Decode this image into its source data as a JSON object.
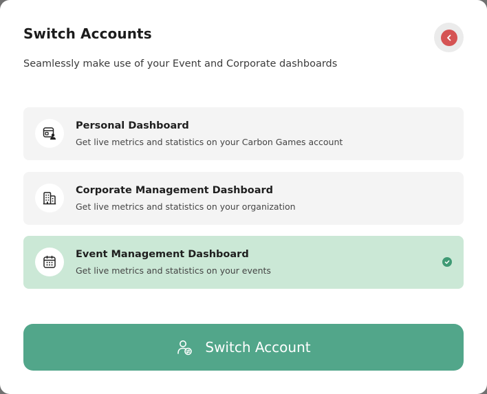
{
  "header": {
    "title": "Switch Accounts",
    "subtitle": "Seamlessly make use of your Event and Corporate dashboards"
  },
  "close_button": {
    "icon": "chevron-left-icon",
    "color": "#d55353"
  },
  "options": [
    {
      "icon": "dashboard-user-icon",
      "title": "Personal Dashboard",
      "description": "Get live metrics and statistics on your Carbon Games account",
      "selected": false
    },
    {
      "icon": "building-icon",
      "title": "Corporate Management Dashboard",
      "description": "Get live metrics and statistics on your organization",
      "selected": false
    },
    {
      "icon": "calendar-icon",
      "title": "Event Management Dashboard",
      "description": "Get live metrics and statistics on your events",
      "selected": true
    }
  ],
  "primary_action": {
    "label": "Switch Account",
    "icon": "user-switch-icon",
    "color": "#52a68a"
  },
  "colors": {
    "selected_card": "#cbe8d6",
    "card": "#f4f4f4",
    "check": "#3f9a74"
  }
}
